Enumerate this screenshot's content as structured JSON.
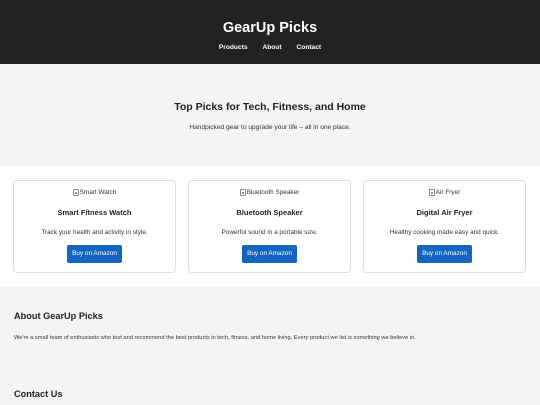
{
  "header": {
    "brand": "GearUp Picks",
    "nav": [
      {
        "label": "Products"
      },
      {
        "label": "About"
      },
      {
        "label": "Contact"
      }
    ]
  },
  "hero": {
    "title": "Top Picks for Tech, Fitness, and Home",
    "subtitle": "Handpicked gear to upgrade your life – all in one place."
  },
  "products": [
    {
      "image_alt": "Smart Watch",
      "title": "Smart Fitness Watch",
      "description": "Track your health and activity in style.",
      "button": "Buy on Amazon"
    },
    {
      "image_alt": "Bluetooth Speaker",
      "title": "Bluetooth Speaker",
      "description": "Powerful sound in a portable size.",
      "button": "Buy on Amazon"
    },
    {
      "image_alt": "Air Fryer",
      "title": "Digital Air Fryer",
      "description": "Healthy cooking made easy and quick.",
      "button": "Buy on Amazon"
    }
  ],
  "about": {
    "title": "About GearUp Picks",
    "text": "We're a small team of enthusiasts who test and recommend the best products in tech, fitness, and home living. Every product we list is something we believe in."
  },
  "contact": {
    "title": "Contact Us"
  },
  "colors": {
    "header_bg": "#222222",
    "button_bg": "#1565c0",
    "section_bg": "#f4f4f4"
  }
}
